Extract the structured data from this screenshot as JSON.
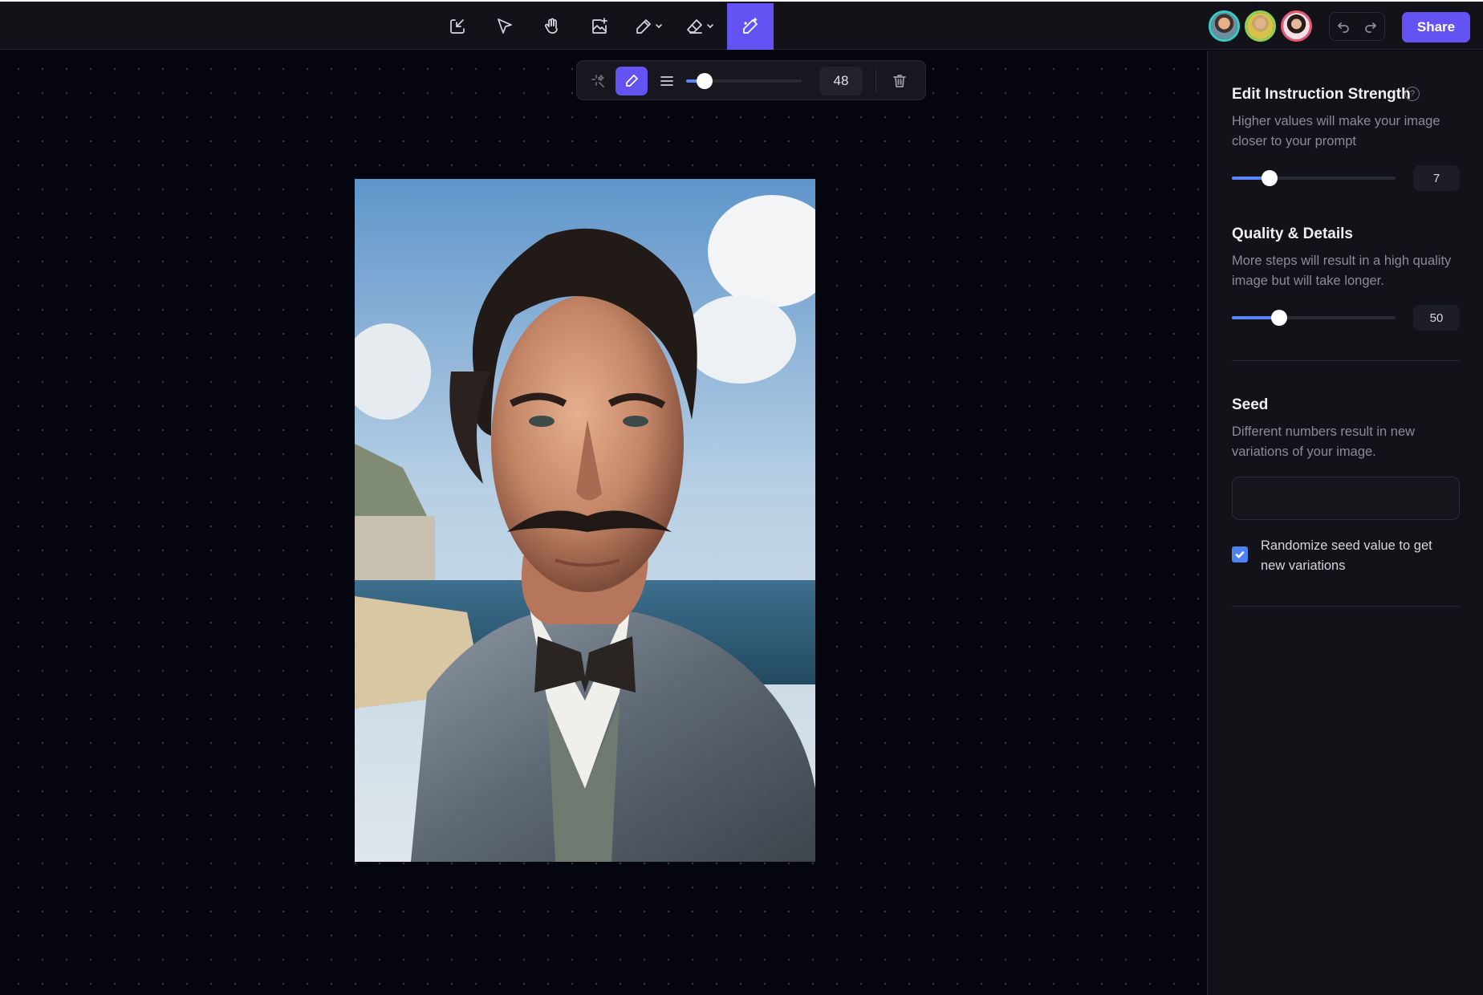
{
  "toolbar": {
    "tools": [
      {
        "name": "import-icon"
      },
      {
        "name": "select-arrow-icon"
      },
      {
        "name": "hand-pan-icon"
      },
      {
        "name": "image-sparkle-icon"
      },
      {
        "name": "pencil-icon",
        "has_caret": true
      },
      {
        "name": "eraser-icon",
        "has_caret": true
      },
      {
        "name": "magic-wand-icon",
        "active": true
      }
    ],
    "accent_color": "#6353f2",
    "undo_icon": "undo-icon",
    "redo_icon": "redo-icon",
    "share_label": "Share"
  },
  "brush_toolbar": {
    "size_value": "48",
    "size_fraction": 0.16,
    "slider_color": "#5a86ff"
  },
  "panel": {
    "edit_strength": {
      "title": "Edit Instruction Strength",
      "help_glyph": "?",
      "description": "Higher values will make your image closer to your prompt",
      "value": "7",
      "fraction": 0.23
    },
    "quality": {
      "title": "Quality & Details",
      "description": "More steps will result in a high quality image but will take longer.",
      "value": "50",
      "fraction": 0.29
    },
    "seed": {
      "title": "Seed",
      "description": "Different numbers result in new variations of your image.",
      "input_value": "",
      "randomize_label": "Randomize seed value to get new variations",
      "randomize_checked": true
    }
  }
}
